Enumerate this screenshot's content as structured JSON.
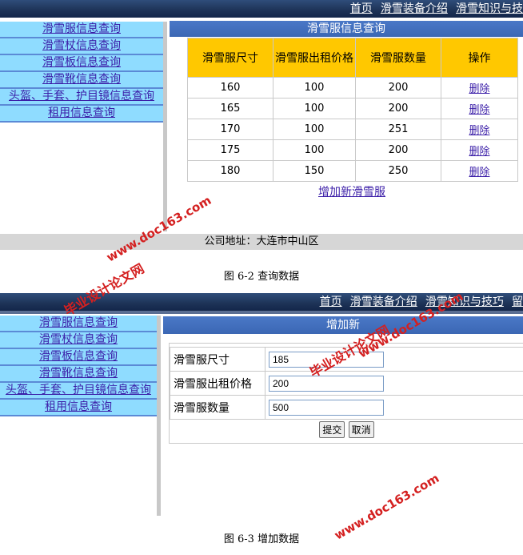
{
  "screen1": {
    "nav": [
      "首页",
      "滑雪装备介绍",
      "滑雪知识与技"
    ],
    "sidebar": [
      "滑雪服信息查询",
      "滑雪杖信息查询",
      "滑雪板信息查询",
      "滑雪靴信息查询",
      "头盔、手套、护目镜信息查询",
      "租用信息查询"
    ],
    "panel_title": "滑雪服信息查询",
    "table": {
      "headers": [
        "滑雪服尺寸",
        "滑雪服出租价格",
        "滑雪服数量",
        "操作"
      ],
      "rows": [
        [
          "160",
          "100",
          "200",
          "删除"
        ],
        [
          "165",
          "100",
          "200",
          "删除"
        ],
        [
          "170",
          "100",
          "251",
          "删除"
        ],
        [
          "175",
          "100",
          "200",
          "删除"
        ],
        [
          "180",
          "150",
          "250",
          "删除"
        ]
      ]
    },
    "add_link": "增加新滑雪服",
    "footer": "公司地址：大连市中山区"
  },
  "caption1": "图 6-2  查询数据",
  "screen2": {
    "nav": [
      "首页",
      "滑雪装备介绍",
      "滑雪知识与技巧",
      "留"
    ],
    "sidebar": [
      "滑雪服信息查询",
      "滑雪杖信息查询",
      "滑雪板信息查询",
      "滑雪靴信息查询",
      "头盔、手套、护目镜信息查询",
      "租用信息查询"
    ],
    "panel_title": "增加新",
    "form": {
      "fields": [
        {
          "label": "滑雪服尺寸",
          "value": "185"
        },
        {
          "label": "滑雪服出租价格",
          "value": "200"
        },
        {
          "label": "滑雪服数量",
          "value": "500"
        }
      ],
      "submit": "提交",
      "cancel": "取消"
    }
  },
  "caption2": "图 6-3  增加数据",
  "watermarks": [
    "www.doc163.com",
    "毕业设计论文网",
    "www.doc163.com",
    "毕业设计论文网",
    "www.doc163.com"
  ]
}
